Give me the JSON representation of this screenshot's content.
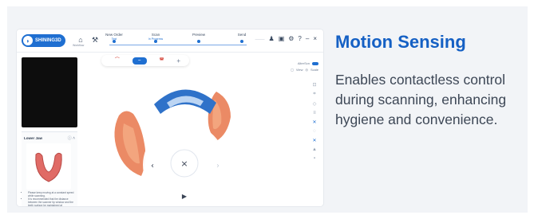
{
  "heading": "Motion Sensing",
  "description": "Enables contactless control during scanning, enhancing hygiene and convenience.",
  "app": {
    "brand": "SHINING3D",
    "home_sub": "Workflow",
    "steps": [
      {
        "name": "New Order",
        "status": "Test"
      },
      {
        "name": "Scan",
        "status": "In Progress"
      },
      {
        "name": "Preview",
        "status": ""
      },
      {
        "name": "Send",
        "status": ""
      }
    ],
    "topright_dim": "———",
    "top_icons": [
      "person-icon",
      "save-icon",
      "gear-icon",
      "help-icon",
      "minimize-icon",
      "close-icon"
    ],
    "panel": {
      "title": "Lower Jaw",
      "notes": [
        "Please keep moving at a constant speed while scanning.",
        "It is recommended that the distance between the scanner tip window and the teeth surface be maintained at"
      ]
    },
    "right_toggle_label": "AlterScn",
    "right_small": [
      "View",
      "Scale"
    ]
  },
  "colors": {
    "accent": "#1560c4",
    "app_blue": "#1f6fd1",
    "tissue": "#e8754a",
    "card_bg": "#f2f4f7"
  }
}
